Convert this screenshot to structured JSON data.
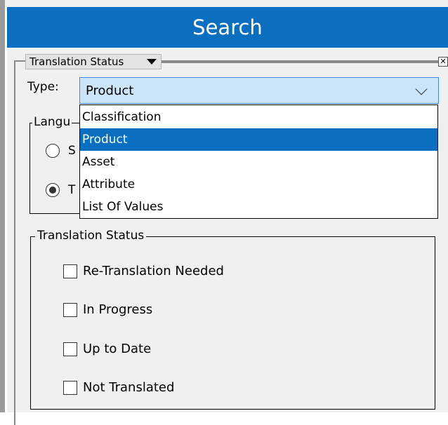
{
  "window": {
    "title": "Search"
  },
  "filter_group": {
    "title": "Translation Status",
    "close_glyph": "✕"
  },
  "type": {
    "label": "Type:",
    "selected": "Product",
    "options": [
      "Classification",
      "Product",
      "Asset",
      "Attribute",
      "List Of Values"
    ]
  },
  "language": {
    "title": "Langu",
    "radio_1_label": "S",
    "radio_2_label": "T",
    "radio_2_checked": true
  },
  "translation_status": {
    "title": "Translation Status",
    "options": [
      "Re-Translation Needed",
      "In Progress",
      "Up to Date",
      "Not Translated"
    ]
  },
  "colors": {
    "accent": "#0a6fc1",
    "select_bg": "#cce4f7"
  }
}
